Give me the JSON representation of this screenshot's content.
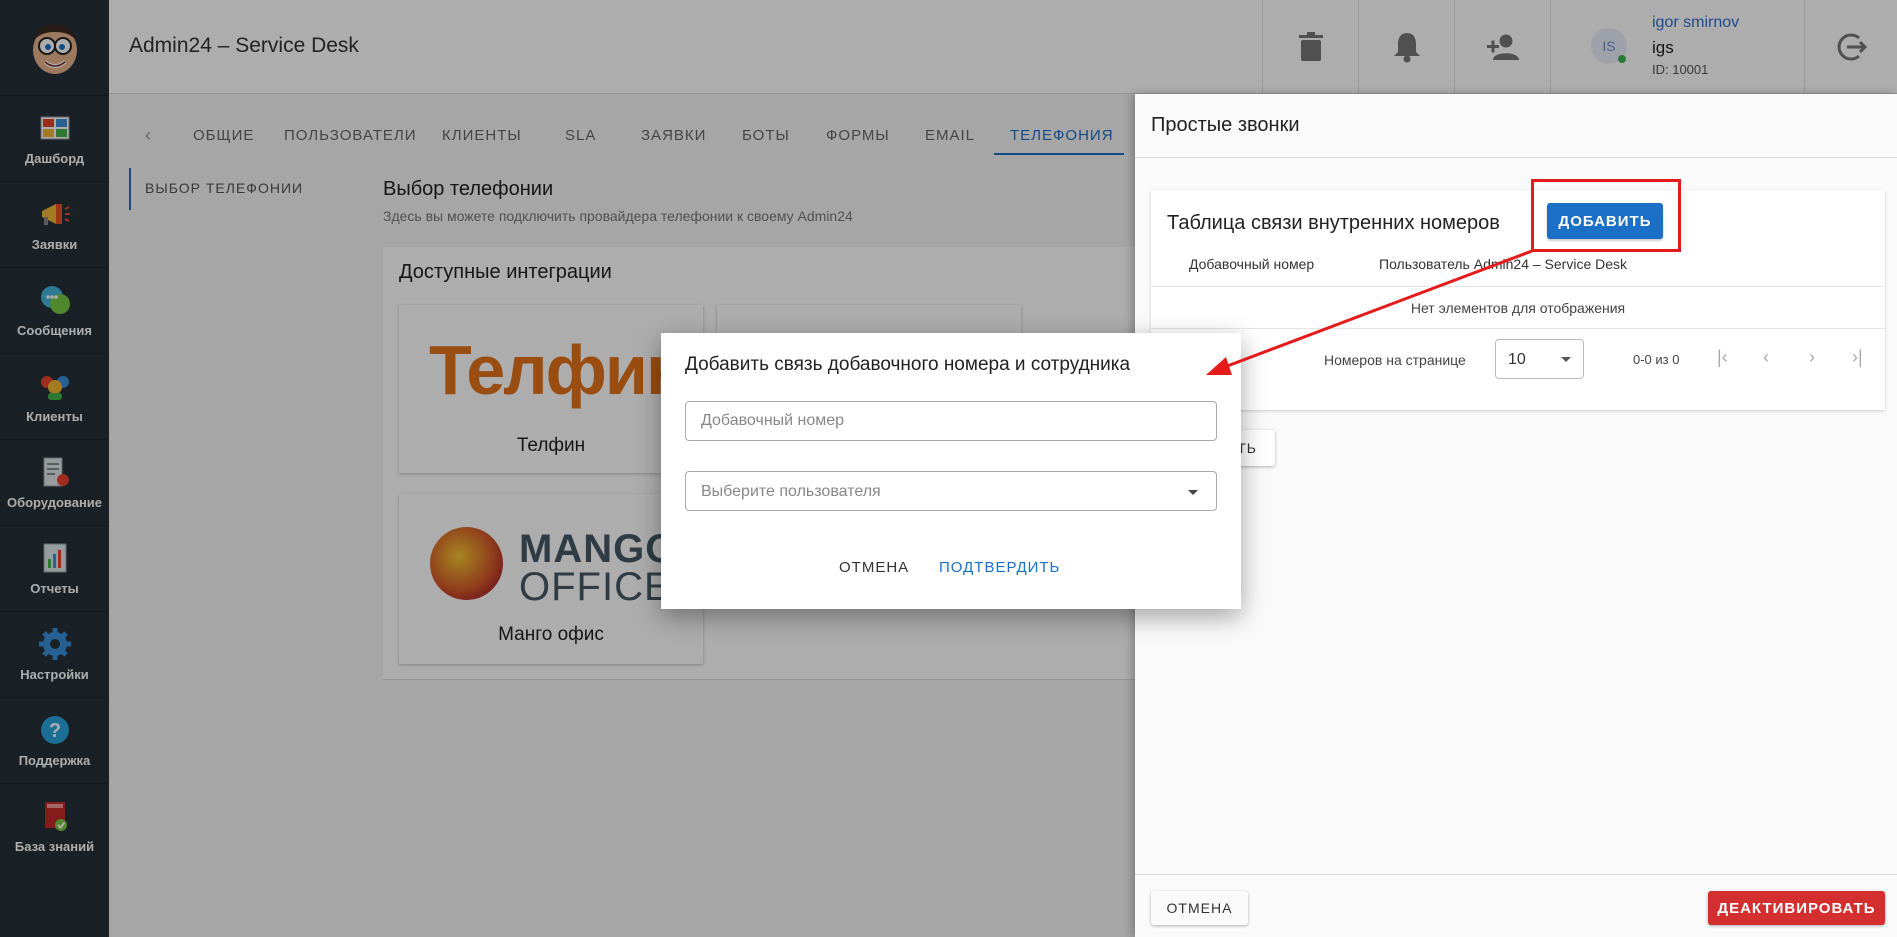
{
  "app": {
    "title": "Admin24 – Service Desk"
  },
  "sidebar": {
    "items": [
      {
        "label": "Дашборд",
        "icon": "dashboard-icon"
      },
      {
        "label": "Заявки",
        "icon": "megaphone-icon"
      },
      {
        "label": "Сообщения",
        "icon": "chat-icon"
      },
      {
        "label": "Клиенты",
        "icon": "clients-icon"
      },
      {
        "label": "Оборудование",
        "icon": "equipment-icon"
      },
      {
        "label": "Отчеты",
        "icon": "reports-icon"
      },
      {
        "label": "Настройки",
        "icon": "gear-icon"
      },
      {
        "label": "Поддержка",
        "icon": "help-icon"
      },
      {
        "label": "База знаний",
        "icon": "book-icon"
      }
    ]
  },
  "header": {
    "user": {
      "initials": "IS",
      "name": "igor smirnov",
      "login": "igs",
      "id": "ID: 10001"
    }
  },
  "tabs": [
    "ОБЩИЕ",
    "ПОЛЬЗОВАТЕЛИ",
    "КЛИЕНТЫ",
    "SLA",
    "ЗАЯВКИ",
    "БОТЫ",
    "ФОРМЫ",
    "EMAIL",
    "ТЕЛЕФОНИЯ"
  ],
  "left_nav": {
    "item": "ВЫБОР ТЕЛЕФОНИИ"
  },
  "section": {
    "title": "Выбор телефонии",
    "subtitle": "Здесь вы можете подключить провайдера телефонии к своему Admin24",
    "integrations_title": "Доступные интеграции",
    "cards": [
      {
        "logo": "Телфин",
        "label": "Телфин"
      },
      {
        "logo_line1": "MANGO",
        "logo_line2": "OFFICE",
        "label": "Манго офис"
      }
    ]
  },
  "drawer": {
    "title": "Простые звонки",
    "table_title": "Таблица связи внутренних номеров",
    "add_label": "ДОБАВИТЬ",
    "columns": [
      "Добавочный номер",
      "Пользователь Admin24 – Service Desk"
    ],
    "empty": "Нет элементов для отображения",
    "per_page_label": "Номеров на странице",
    "per_page_value": "10",
    "range": "0-0 из 0",
    "partial_button": "ТЬ",
    "cancel_label": "ОТМЕНА",
    "deactivate_label": "ДЕАКТИВИРОВАТЬ"
  },
  "modal": {
    "title": "Добавить связь добавочного номера и сотрудника",
    "ext_placeholder": "Добавочный номер",
    "user_placeholder": "Выберите пользователя",
    "cancel_label": "ОТМЕНА",
    "confirm_label": "ПОДТВЕРДИТЬ"
  },
  "colors": {
    "accent": "#1b6fc6",
    "danger": "#d32f2f",
    "sidebar": "#263238",
    "annotation": "#e51a1a"
  }
}
